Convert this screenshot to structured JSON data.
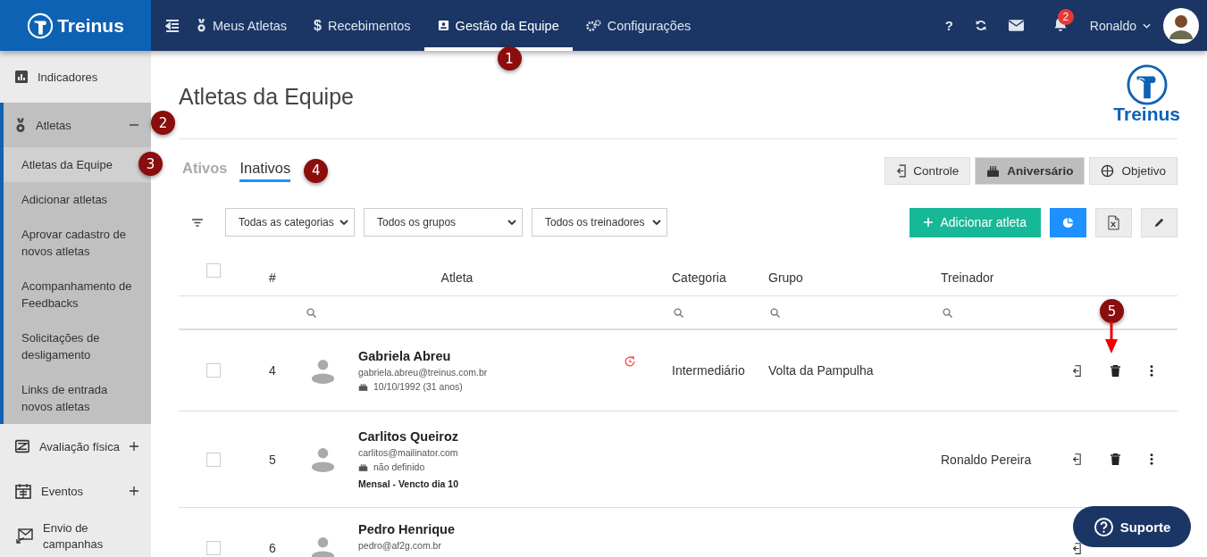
{
  "brand": {
    "name": "Treinus"
  },
  "topnav": [
    {
      "label": "Meus Atletas",
      "selected": false
    },
    {
      "label": "Recebimentos",
      "glyph": "$",
      "selected": false
    },
    {
      "label": "Gestão da Equipe",
      "selected": true,
      "callout": "1"
    },
    {
      "label": "Configurações",
      "selected": false
    }
  ],
  "header": {
    "help": "?",
    "notifications_badge": "2",
    "user": "Ronaldo"
  },
  "sidebar": {
    "items": [
      {
        "label": "Indicadores"
      },
      {
        "label": "Atletas",
        "expanded": true,
        "callout": "2",
        "children": [
          {
            "label": "Atletas da Equipe",
            "selected": true,
            "callout": "3"
          },
          {
            "label": "Adicionar atletas",
            "selected": false
          },
          {
            "label": "Aprovar cadastro de novos atletas",
            "selected": false
          },
          {
            "label": "Acompanhamento de Feedbacks",
            "selected": false
          },
          {
            "label": "Solicitações de desligamento",
            "selected": false
          },
          {
            "label": "Links de entrada novos atletas",
            "selected": false
          }
        ]
      },
      {
        "label": "Avaliação física",
        "expanded": false
      },
      {
        "label": "Eventos",
        "expanded": false
      },
      {
        "label": "Envio de campanhas"
      }
    ]
  },
  "page": {
    "title": "Atletas da Equipe",
    "logo": "Treinus"
  },
  "tabs": [
    {
      "label": "Ativos",
      "selected": false
    },
    {
      "label": "Inativos",
      "selected": true,
      "callout": "4"
    }
  ],
  "views": [
    {
      "label": "Controle",
      "selected": false
    },
    {
      "label": "Aniversário",
      "selected": true
    },
    {
      "label": "Objetivo",
      "selected": false
    }
  ],
  "filters": [
    {
      "value": "Todas as categorias"
    },
    {
      "value": "Todos os grupos"
    },
    {
      "value": "Todos os treinadores"
    }
  ],
  "add_button": "Adicionar atleta",
  "table": {
    "columns": [
      "#",
      "Atleta",
      "Categoria",
      "Grupo",
      "Treinador"
    ],
    "all_checked": false,
    "delete_callout": "5",
    "rows": [
      {
        "number": "4",
        "name": "Gabriela Abreu",
        "email": "gabriela.abreu@treinus.com.br",
        "birthday": "10/10/1992 (31 anos)",
        "alert": true,
        "category": "Intermediário",
        "group": "Volta da Pampulha",
        "checked": false
      },
      {
        "number": "5",
        "name": "Carlitos Queiroz",
        "email": "carlitos@mailinator.com",
        "birthday": "não definido",
        "plan": "Mensal - Vencto dia 10",
        "alert": false,
        "coach": "Ronaldo Pereira",
        "checked": false
      },
      {
        "number": "6",
        "name": "Pedro Henrique",
        "email": "pedro@af2g.com.br",
        "alert": false,
        "checked": false
      }
    ]
  },
  "support_button": "Suporte"
}
